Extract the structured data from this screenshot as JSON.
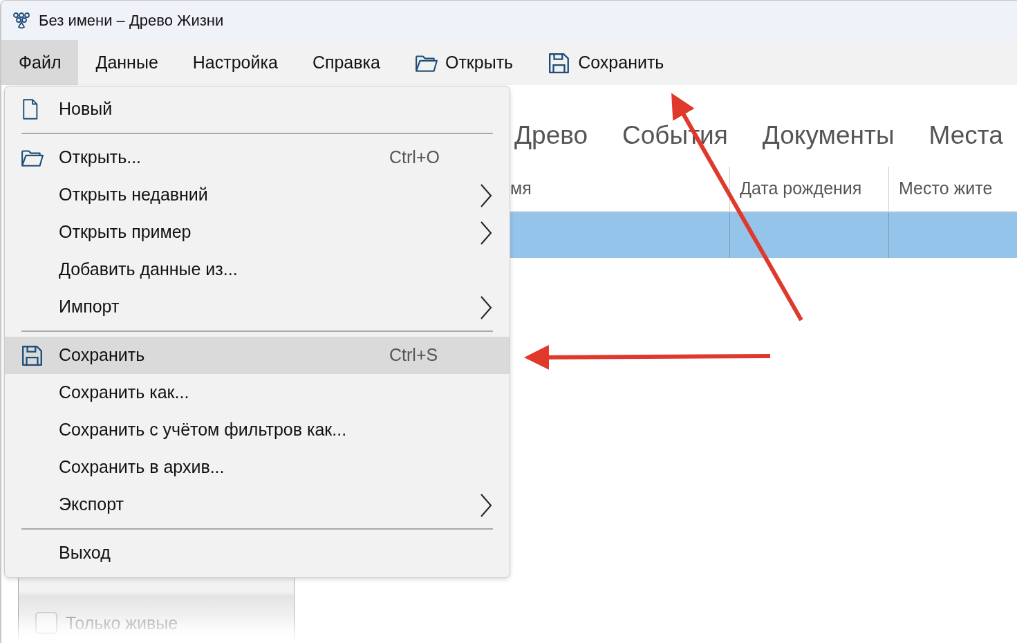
{
  "window": {
    "title": "Без имени – Древо Жизни"
  },
  "menu_bar": [
    {
      "label": "Файл",
      "kind": "menu",
      "selected": true
    },
    {
      "label": "Данные",
      "kind": "menu",
      "selected": false
    },
    {
      "label": "Настройка",
      "kind": "menu",
      "selected": false
    },
    {
      "label": "Справка",
      "kind": "menu",
      "selected": false
    },
    {
      "label": "Открыть",
      "kind": "open",
      "selected": false
    },
    {
      "label": "Сохранить",
      "kind": "save",
      "selected": false
    }
  ],
  "file_menu": {
    "sections": [
      [
        {
          "label": "Новый",
          "kind": "new",
          "selected": false
        }
      ],
      [
        {
          "label": "Открыть...",
          "kind": "open",
          "shortcut": "Ctrl+O",
          "selected": false
        },
        {
          "label": "Открыть недавний",
          "kind": "plain",
          "submenu": true,
          "selected": false
        },
        {
          "label": "Открыть пример",
          "kind": "plain",
          "submenu": true,
          "selected": false
        },
        {
          "label": "Добавить данные из...",
          "kind": "plain",
          "selected": false
        },
        {
          "label": "Импорт",
          "kind": "plain",
          "submenu": true,
          "selected": false
        }
      ],
      [
        {
          "label": "Сохранить",
          "kind": "save",
          "shortcut": "Ctrl+S",
          "selected": true
        },
        {
          "label": "Сохранить как...",
          "kind": "plain",
          "selected": false
        },
        {
          "label": "Сохранить с учётом фильтров как...",
          "kind": "plain",
          "selected": false
        },
        {
          "label": "Сохранить в архив...",
          "kind": "plain",
          "selected": false
        },
        {
          "label": "Экспорт",
          "kind": "plain",
          "submenu": true,
          "selected": false
        }
      ],
      [
        {
          "label": "Выход",
          "kind": "plain",
          "selected": false
        }
      ]
    ]
  },
  "view_tabs": [
    {
      "label": "Древо"
    },
    {
      "label": "События"
    },
    {
      "label": "Документы"
    },
    {
      "label": "Места"
    }
  ],
  "table": {
    "columns": [
      "мя",
      "Дата рождения",
      "Место жите"
    ],
    "rows": [
      {
        "selected": true
      }
    ]
  },
  "sidebar": {
    "filter": {
      "label": "Только живые",
      "checked": false,
      "disabled": true
    }
  }
}
